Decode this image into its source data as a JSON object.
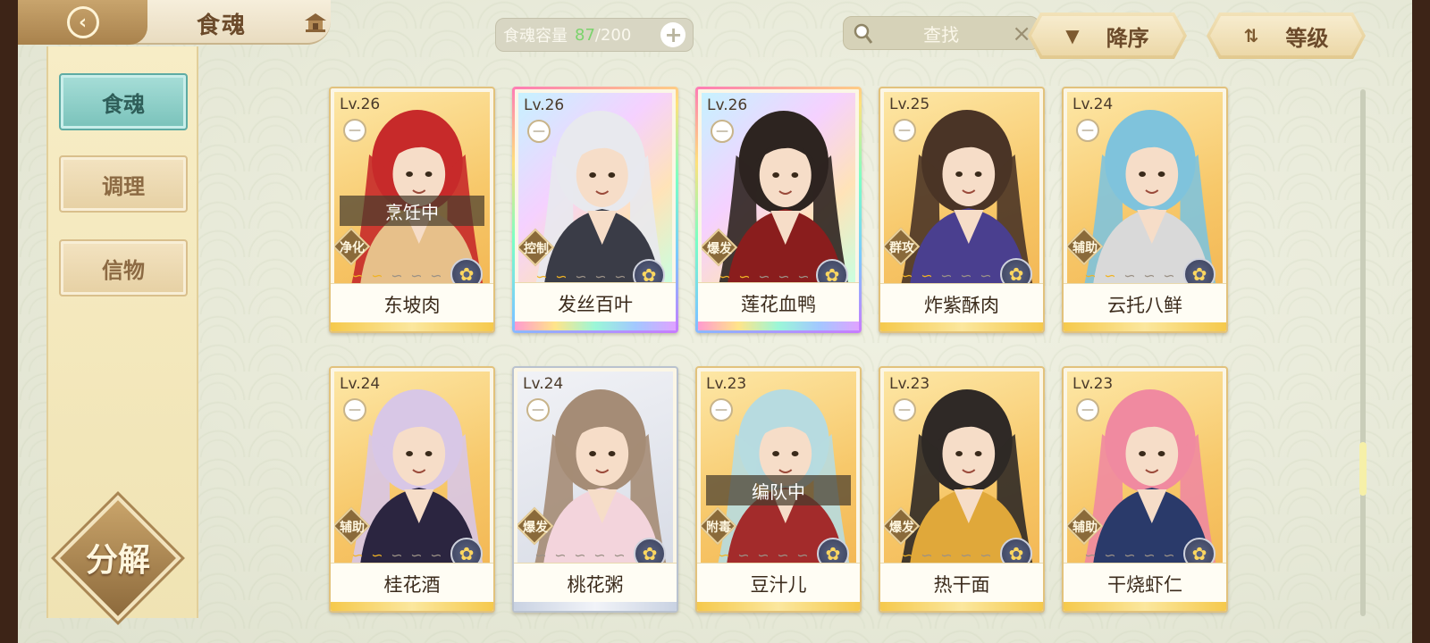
{
  "header": {
    "title": "食魂",
    "capacity_label": "食魂容量",
    "capacity_current": "87",
    "capacity_total": "/200",
    "search_label": "查找",
    "sort_order_label": "降序",
    "sort_key_label": "等级"
  },
  "sidebar": {
    "items": [
      {
        "label": "食魂",
        "active": true
      },
      {
        "label": "调理",
        "active": false
      },
      {
        "label": "信物",
        "active": false
      }
    ],
    "decompose_label": "分解"
  },
  "cards": [
    {
      "level": "Lv.26",
      "name": "东坡肉",
      "role": "净化",
      "status": "烹饪中",
      "rarity": "gold",
      "stars_on": 2,
      "hair": "#c72a2a",
      "outfit": "#e7c08a"
    },
    {
      "level": "Lv.26",
      "name": "发丝百叶",
      "role": "控制",
      "status": "",
      "rarity": "rainbow",
      "stars_on": 2,
      "hair": "#e8e9ee",
      "outfit": "#3a3c47"
    },
    {
      "level": "Lv.26",
      "name": "莲花血鸭",
      "role": "爆发",
      "status": "",
      "rarity": "rainbow",
      "stars_on": 2,
      "hair": "#2d2420",
      "outfit": "#8a1d1d"
    },
    {
      "level": "Lv.25",
      "name": "炸紫酥肉",
      "role": "群攻",
      "status": "",
      "rarity": "gold",
      "stars_on": 2,
      "hair": "#4a3426",
      "outfit": "#4a3f8f"
    },
    {
      "level": "Lv.24",
      "name": "云托八鲜",
      "role": "辅助",
      "status": "",
      "rarity": "gold",
      "stars_on": 2,
      "hair": "#7fc3dc",
      "outfit": "#d9d9d9"
    },
    {
      "level": "Lv.24",
      "name": "桂花酒",
      "role": "辅助",
      "status": "",
      "rarity": "gold",
      "stars_on": 2,
      "hair": "#d8c7e6",
      "outfit": "#2b2540"
    },
    {
      "level": "Lv.24",
      "name": "桃花粥",
      "role": "爆发",
      "status": "",
      "rarity": "silver",
      "stars_on": 0,
      "hair": "#a58c76",
      "outfit": "#f3d4dc"
    },
    {
      "level": "Lv.23",
      "name": "豆汁儿",
      "role": "附毒",
      "status": "编队中",
      "rarity": "gold",
      "stars_on": 1,
      "hair": "#b7dbe0",
      "outfit": "#a32b2b"
    },
    {
      "level": "Lv.23",
      "name": "热干面",
      "role": "爆发",
      "status": "",
      "rarity": "gold",
      "stars_on": 1,
      "hair": "#2f2926",
      "outfit": "#e0a83a"
    },
    {
      "level": "Lv.23",
      "name": "干烧虾仁",
      "role": "辅助",
      "status": "",
      "rarity": "gold",
      "stars_on": 0,
      "hair": "#f08aa0",
      "outfit": "#2a3a6a"
    }
  ]
}
